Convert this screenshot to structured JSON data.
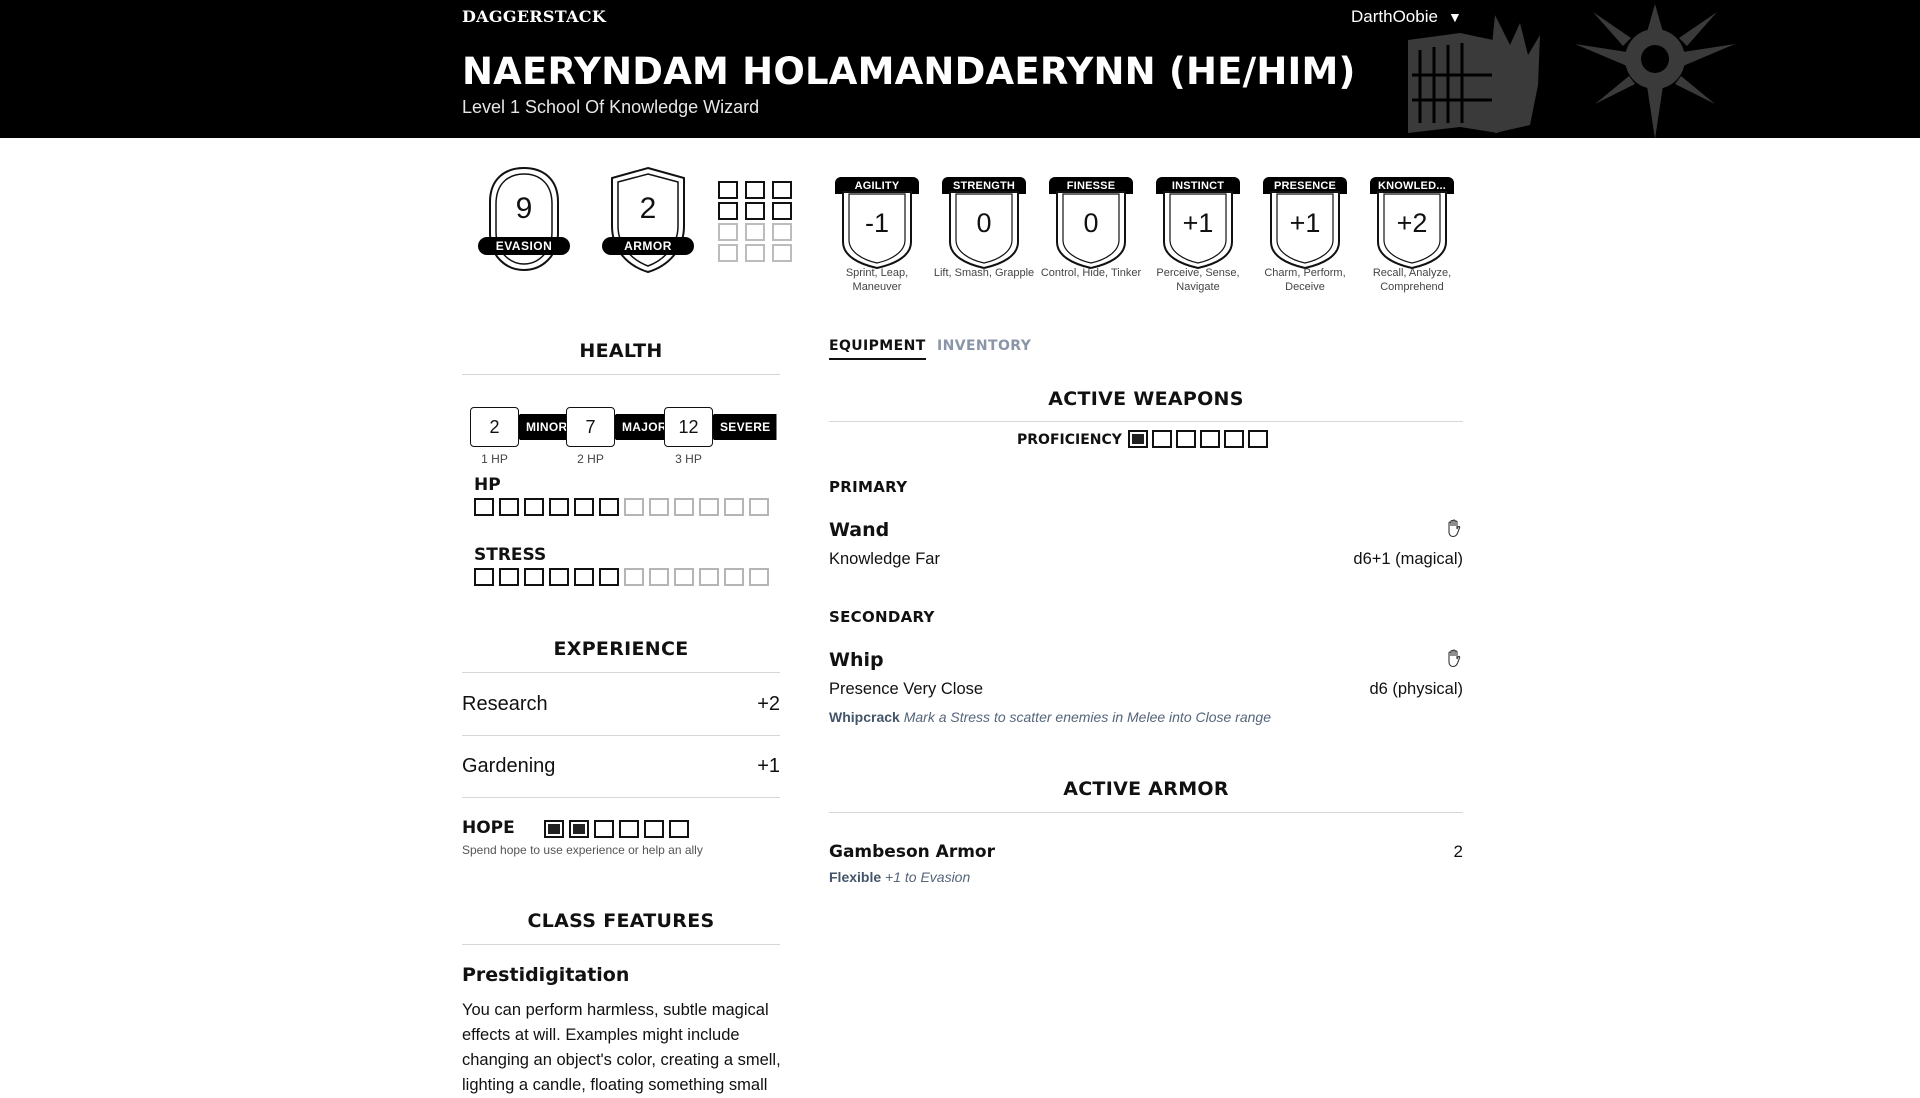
{
  "header": {
    "logo": "DAGGERSTACK",
    "user": "DarthOobie",
    "user_caret": "▼",
    "character_name": "NAERYNDAM HOLAMANDAERYNN (HE/HIM)",
    "subtitle": "Level 1 School Of Knowledge Wizard"
  },
  "defense": {
    "evasion": {
      "value": "9",
      "label": "EVASION"
    },
    "armor": {
      "value": "2",
      "label": "ARMOR"
    },
    "armor_slots": {
      "total": 12,
      "marked": 0,
      "available": 6
    }
  },
  "traits": [
    {
      "label": "AGILITY",
      "value": "-1",
      "desc": "Sprint, Leap, Maneuver"
    },
    {
      "label": "STRENGTH",
      "value": "0",
      "desc": "Lift, Smash, Grapple"
    },
    {
      "label": "FINESSE",
      "value": "0",
      "desc": "Control, Hide, Tinker"
    },
    {
      "label": "INSTINCT",
      "value": "+1",
      "desc": "Perceive, Sense, Navigate"
    },
    {
      "label": "PRESENCE",
      "value": "+1",
      "desc": "Charm, Perform, Deceive"
    },
    {
      "label": "KNOWLED...",
      "value": "+2",
      "desc": "Recall, Analyze, Comprehend"
    }
  ],
  "health": {
    "title": "HEALTH",
    "thresholds": [
      {
        "value": "2",
        "tag": "MINOR",
        "hp": "1 HP"
      },
      {
        "value": "7",
        "tag": "MAJOR",
        "hp": "2 HP"
      },
      {
        "value": "12",
        "tag": "SEVERE",
        "hp": "3 HP"
      }
    ],
    "hp": {
      "label": "HP",
      "total": 12,
      "available": 6,
      "marked": 0
    },
    "stress": {
      "label": "STRESS",
      "total": 12,
      "available": 6,
      "marked": 0
    }
  },
  "experience": {
    "title": "EXPERIENCE",
    "items": [
      {
        "name": "Research",
        "bonus": "+2"
      },
      {
        "name": "Gardening",
        "bonus": "+1"
      }
    ]
  },
  "hope": {
    "label": "HOPE",
    "total": 6,
    "filled": 2,
    "hint": "Spend hope to use experience or help an ally"
  },
  "class_features": {
    "title": "CLASS FEATURES",
    "feature_name": "Prestidigitation",
    "feature_text": "You can perform harmless, subtle magical effects at will. Examples might include changing an object's color, creating a smell, lighting a candle, floating something small"
  },
  "tabs": [
    {
      "label": "EQUIPMENT",
      "active": true
    },
    {
      "label": "INVENTORY",
      "active": false
    }
  ],
  "weapons": {
    "title": "ACTIVE WEAPONS",
    "proficiency_label": "PROFICIENCY",
    "proficiency": {
      "total": 6,
      "filled": 1
    },
    "primary_label": "PRIMARY",
    "primary": {
      "name": "Wand",
      "info": "Knowledge Far",
      "damage": "d6+1 (magical)"
    },
    "secondary_label": "SECONDARY",
    "secondary": {
      "name": "Whip",
      "info": "Presence Very Close",
      "damage": "d6 (physical)",
      "feature_name": "Whipcrack",
      "feature_text": "Mark a Stress to scatter enemies in Melee into Close range"
    }
  },
  "armor": {
    "title": "ACTIVE ARMOR",
    "name": "Gambeson Armor",
    "score": "2",
    "feature_name": "Flexible",
    "feature_text": "+1 to Evasion"
  },
  "icons": {
    "grab": "hand-grab-icon",
    "caret": "caret-down-icon",
    "book_flame": "book-flame-icon",
    "sun_sigil": "sun-sigil-icon"
  },
  "colors": {
    "header_bg": "#000000",
    "accent_dark": "#111111",
    "muted_tab": "#8a96a8",
    "feature_text": "#55657a"
  }
}
